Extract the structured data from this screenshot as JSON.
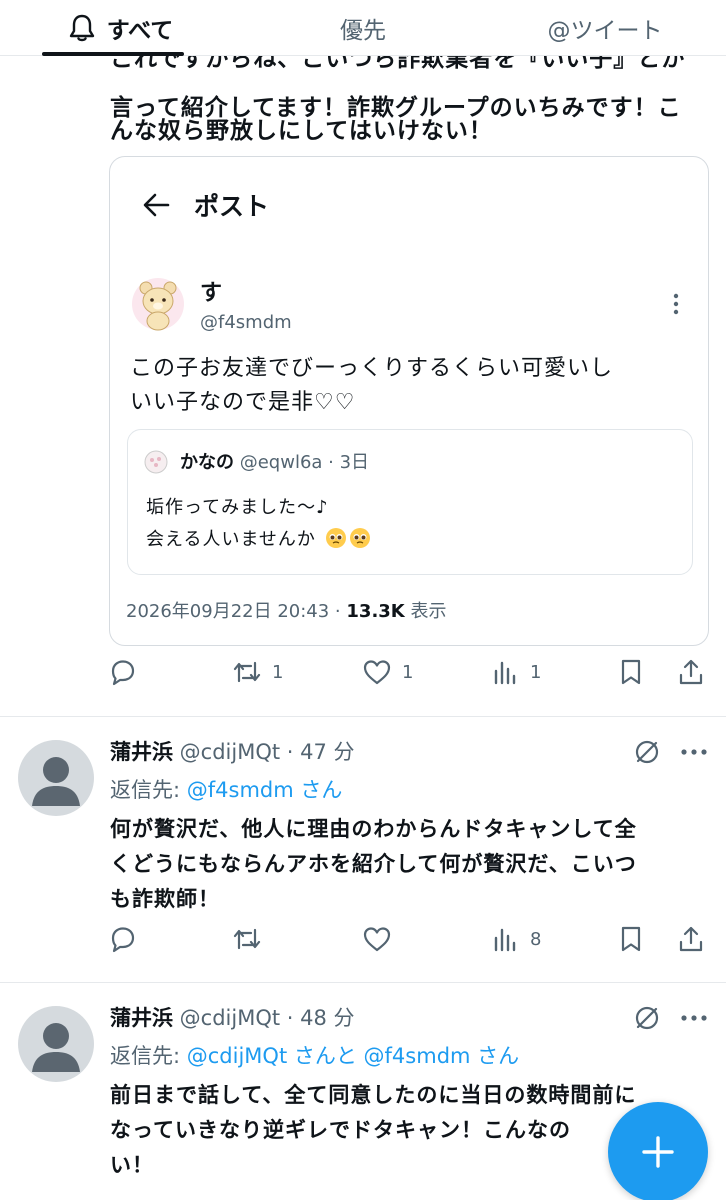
{
  "tabs": [
    {
      "label": "すべて",
      "active": true
    },
    {
      "label": "優先",
      "active": false
    },
    {
      "label": "@ツイート",
      "active": false
    }
  ],
  "post": {
    "text_lines": [
      "これですからね、こいつら詐欺業者を『いい子』とか",
      "言って紹介してます！詐欺グループのいちみです！こ",
      "んな奴ら野放しにしてはいけない！"
    ],
    "actions": {
      "reply": "",
      "retweet": "1",
      "like": "1",
      "views": "1"
    }
  },
  "embedded": {
    "header_title": "ポスト",
    "author_name": "す",
    "author_handle": "@f4smdm",
    "text_lines": [
      "この子お友達でびーっくりするくらい可愛いし",
      "いい子なので是非♡♡"
    ],
    "quote": {
      "name": "かなの",
      "meta": "@eqwl6a · 3日",
      "line1": "垢作ってみました〜♪",
      "line2": "会える人いませんか"
    },
    "timestamp": "2026年09月22日 20:43 · ",
    "views_count": "13.3K",
    "views_label": " 表示"
  },
  "replies": [
    {
      "name": "蒲井浜",
      "meta": " @cdijMQt · 47 分",
      "reply_to_label": "返信先: ",
      "reply_to_mentions": "@f4smdm さん",
      "text_lines": [
        "何が贅沢だ、他人に理由のわからんドタキャンして全",
        "くどうにもならんアホを紹介して何が贅沢だ、こいつ",
        "も詐欺師！"
      ],
      "views": "8"
    },
    {
      "name": "蒲井浜",
      "meta": " @cdijMQt · 48 分",
      "reply_to_label": "返信先: ",
      "reply_to_mentions": "@cdijMQt さんと @f4smdm さん",
      "text_lines": [
        "前日まで話して、全て同意したのに当日の数時間前に",
        "なっていきなり逆ギレでドタキャン！こんなの",
        "い！"
      ]
    }
  ],
  "colors": {
    "accent": "#1d9bf0",
    "text": "#0f1419",
    "muted": "#536471",
    "border": "#e6e9ec"
  },
  "icons": [
    "bell-icon",
    "back-arrow-icon",
    "more-vertical-icon",
    "reply-icon",
    "retweet-icon",
    "like-icon",
    "views-icon",
    "bookmark-icon",
    "share-icon",
    "mute-icon",
    "more-horizontal-icon",
    "compose-plus-icon"
  ]
}
